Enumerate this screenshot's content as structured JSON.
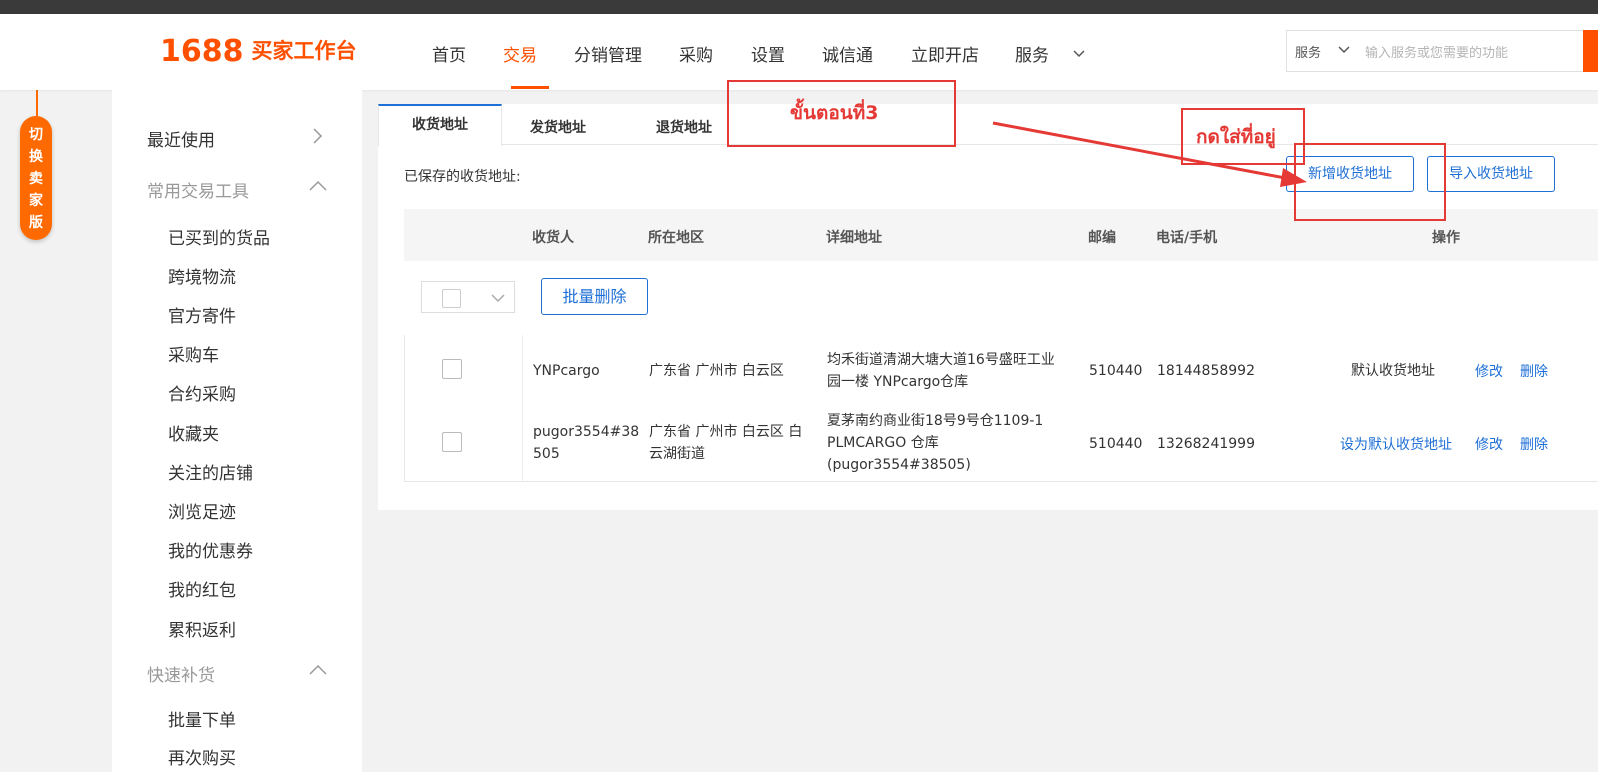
{
  "header": {
    "logo_num": "1688",
    "logo_text": "买家工作台",
    "nav": [
      "首页",
      "交易",
      "分销管理",
      "采购",
      "设置",
      "诚信通",
      "立即开店",
      "服务"
    ],
    "search": {
      "category": "服务",
      "placeholder": "输入服务或您需要的功能"
    }
  },
  "switch_seller": "切换卖家版",
  "sidebar": {
    "recent": "最近使用",
    "group1": "常用交易工具",
    "group1_items": [
      "已买到的货品",
      "跨境物流",
      "官方寄件",
      "采购车",
      "合约采购",
      "收藏夹",
      "关注的店铺",
      "浏览足迹",
      "我的优惠券",
      "我的红包",
      "累积返利"
    ],
    "group2": "快速补货",
    "group2_items": [
      "批量下单",
      "再次购买"
    ]
  },
  "tabs": [
    "收货地址",
    "发货地址",
    "退货地址"
  ],
  "saved_label": "已保存的收货地址:",
  "buttons": {
    "add": "新增收货地址",
    "import": "导入收货地址",
    "bulk_delete": "批量删除"
  },
  "table": {
    "headers": [
      "收货人",
      "所在地区",
      "详细地址",
      "邮编",
      "电话/手机",
      "操作"
    ],
    "rows": [
      {
        "name": "YNPcargo",
        "region": "广东省 广州市 白云区",
        "address": "均禾街道清湖大塘大道16号盛旺工业园一楼 YNPcargo仓库",
        "zip": "510440",
        "phone": "18144858992",
        "status": "默认收货地址",
        "edit": "修改",
        "delete": "删除"
      },
      {
        "name": "pugor3554#38505",
        "region": "广东省 广州市 白云区 白云湖街道",
        "address": "夏茅南约商业街18号9号仓1109-1 PLMCARGO 仓库 (pugor3554#38505)",
        "zip": "510440",
        "phone": "13268241999",
        "status": "设为默认收货地址",
        "edit": "修改",
        "delete": "删除"
      }
    ]
  },
  "annotations": {
    "step": "ขั้นตอนที่3",
    "hint": "กดใส่ที่อยู่"
  },
  "colors": {
    "brand": "#ff5000",
    "link": "#1e6fd6",
    "annotation": "#e53935"
  }
}
